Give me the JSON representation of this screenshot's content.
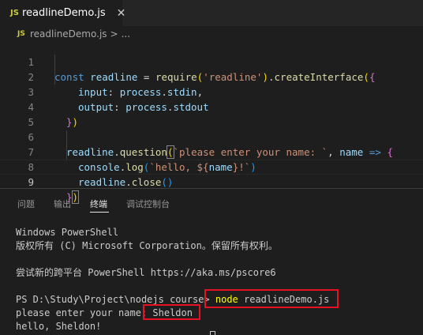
{
  "tab": {
    "lang_badge": "JS",
    "title": "readlineDemo.js",
    "close_glyph": "✕"
  },
  "breadcrumb": {
    "lang_badge": "JS",
    "file": "readlineDemo.js",
    "separator": ">",
    "more": "..."
  },
  "editor": {
    "line_numbers": [
      "1",
      "2",
      "3",
      "4",
      "5",
      "6",
      "7",
      "8",
      "9"
    ],
    "active_line": 9,
    "tokens": {
      "l1": [
        "const",
        " ",
        "readline",
        " = ",
        "require",
        "(",
        "'readline'",
        ")",
        ".",
        "createInterface",
        "(",
        "{"
      ],
      "l2": [
        "input",
        ": ",
        "process",
        ".",
        "stdin",
        ","
      ],
      "l3": [
        "output",
        ": ",
        "process",
        ".",
        "stdout"
      ],
      "l4": [
        "}",
        ")"
      ],
      "l6": [
        "readline",
        ".",
        "question",
        "(",
        "`please enter your name: `",
        ", ",
        "name",
        " => ",
        "{"
      ],
      "l7": [
        "console",
        ".",
        "log",
        "(",
        "`hello, ${",
        "name",
        "}!`",
        ")"
      ],
      "l8": [
        "readline",
        ".",
        "close",
        "()"
      ],
      "l9": [
        "}",
        ")"
      ]
    }
  },
  "panel": {
    "tabs": [
      "问题",
      "输出",
      "终端",
      "调试控制台"
    ],
    "active_tab": "终端"
  },
  "terminal": {
    "lines": [
      "Windows PowerShell",
      "版权所有 (C) Microsoft Corporation。保留所有权利。",
      "",
      "尝试新的跨平台 PowerShell https://aka.ms/pscore6",
      "",
      "PS D:\\Study\\Project\\nodejs course> ",
      "please enter your name: ",
      "hello, Sheldon!"
    ],
    "command_program": "node",
    "command_args": " readlineDemo.js",
    "user_input": "Sheldon"
  },
  "colors": {
    "highlight_box": "#e81123",
    "command": "#ffff00"
  }
}
